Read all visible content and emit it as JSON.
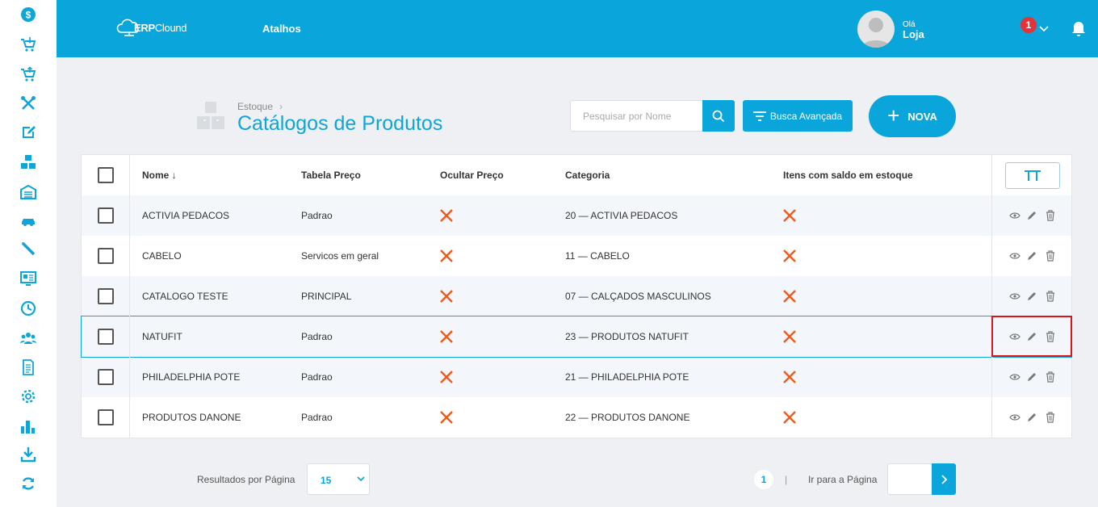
{
  "header": {
    "logo_text_bold": "ERP",
    "logo_text": "Clound",
    "shortcuts": "Atalhos",
    "greeting": "Olá",
    "user_name": "Loja",
    "notification_count": "1"
  },
  "sidebar": {
    "icons": [
      "dollar-icon",
      "cart-in-icon",
      "cart-out-icon",
      "tools-icon",
      "edit-icon",
      "boxes-icon",
      "warehouse-icon",
      "car-icon",
      "pencil-icon",
      "monitor-icon",
      "clock-icon",
      "users-icon",
      "document-icon",
      "gear-icon",
      "bar-chart-icon",
      "download-icon",
      "sync-icon"
    ]
  },
  "page": {
    "breadcrumb": "Estoque",
    "title": "Catálogos de Produtos"
  },
  "toolbar": {
    "search_placeholder": "Pesquisar por Nome",
    "advanced_search": "Busca Avançada",
    "new_button": "NOVA"
  },
  "table": {
    "headers": {
      "name": "Nome ↓",
      "price_table": "Tabela Preço",
      "hide_price": "Ocultar Preço",
      "category": "Categoria",
      "items_stock": "Itens com saldo em estoque"
    },
    "rows": [
      {
        "name": "ACTIVIA PEDACOS",
        "price_table": "Padrao",
        "hide_price": false,
        "category": "20 — ACTIVIA PEDACOS",
        "items_stock": false
      },
      {
        "name": "CABELO",
        "price_table": "Servicos em geral",
        "hide_price": false,
        "category": "11 — CABELO",
        "items_stock": false
      },
      {
        "name": "CATALOGO TESTE",
        "price_table": "PRINCIPAL",
        "hide_price": false,
        "category": "07 — CALÇADOS MASCULINOS",
        "items_stock": false
      },
      {
        "name": "NATUFIT",
        "price_table": "Padrao",
        "hide_price": false,
        "category": "23 — PRODUTOS NATUFIT",
        "items_stock": false
      },
      {
        "name": "PHILADELPHIA POTE",
        "price_table": "Padrao",
        "hide_price": false,
        "category": "21 — PHILADELPHIA POTE",
        "items_stock": false
      },
      {
        "name": "PRODUTOS DANONE",
        "price_table": "Padrao",
        "hide_price": false,
        "category": "22 — PRODUTOS DANONE",
        "items_stock": false
      }
    ],
    "selected_row": 3
  },
  "pagination": {
    "results_per_page_label": "Resultados por Página",
    "results_per_page": "15",
    "current_page": "1",
    "separator": "|",
    "goto_label": "Ir para a Página"
  },
  "colors": {
    "primary": "#0aa5da",
    "x_mark": "#f05a1a",
    "highlight": "#d9161c",
    "badge": "#e53238"
  }
}
